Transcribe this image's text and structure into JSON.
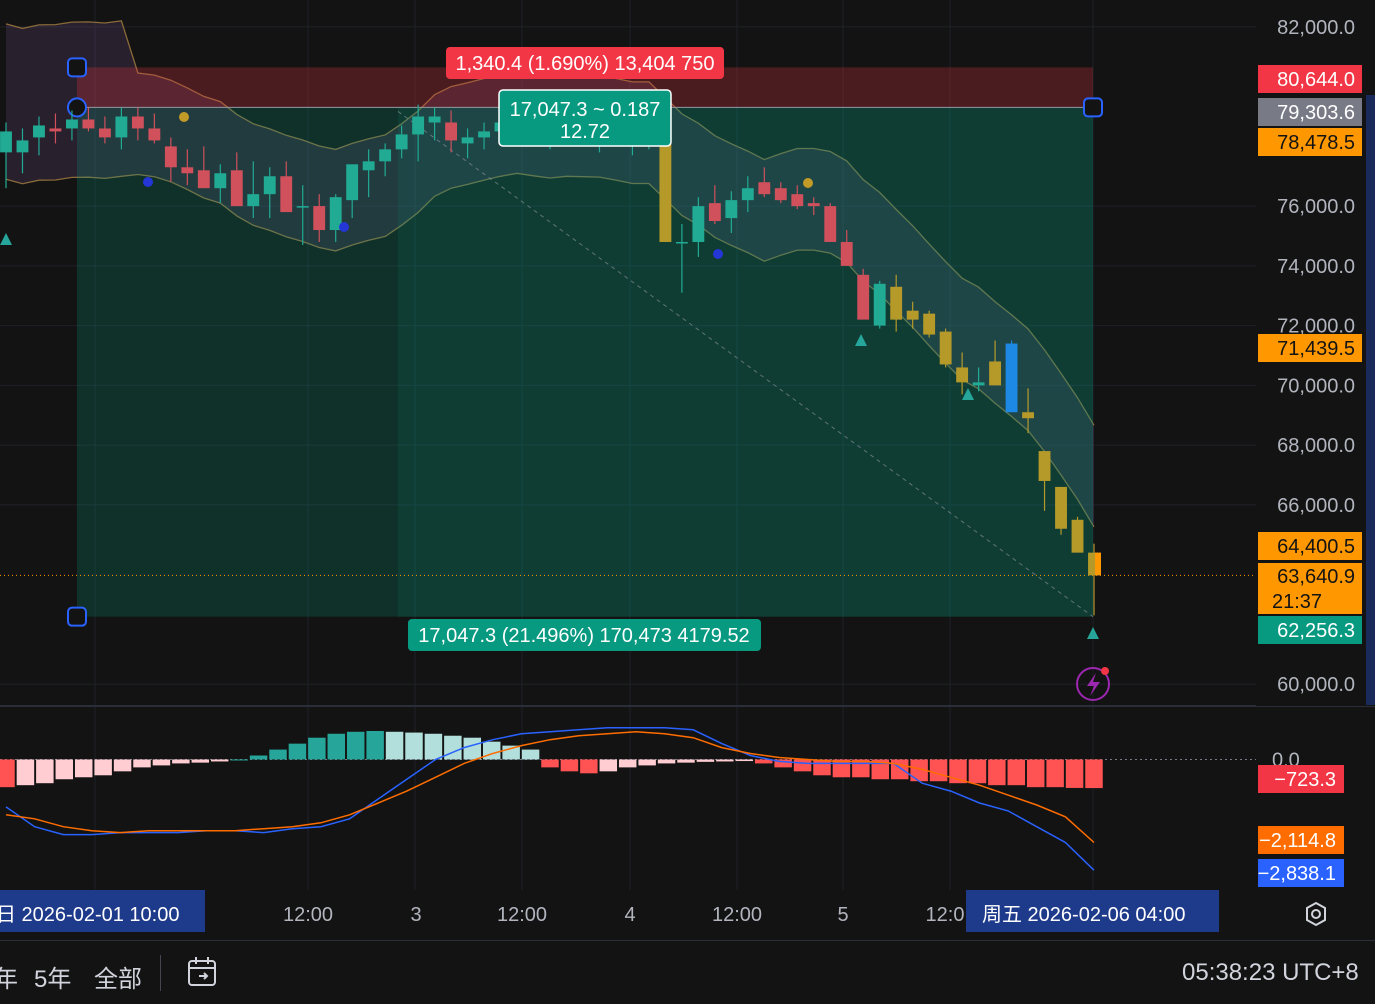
{
  "colors": {
    "background": "#131313",
    "up": "#089981",
    "down": "#f23645",
    "macd_line": "#2962ff",
    "signal_line": "#ff6d00",
    "hist_up_strong": "#26a69a",
    "hist_up_weak": "#b2dfdb",
    "hist_down_strong": "#ff5252",
    "hist_down_weak": "#ffcdd2",
    "label_red": "#f23645",
    "label_orange": "#ff9800",
    "label_green": "#089981",
    "label_gray": "#787b86"
  },
  "price_axis": {
    "ticks": [
      "82,000.0",
      "76,000.0",
      "74,000.0",
      "72,000.0",
      "70,000.0",
      "68,000.0",
      "66,000.0",
      "60,000.0"
    ],
    "tick_values": [
      82000,
      76000,
      74000,
      72000,
      70000,
      68000,
      66000,
      60000
    ],
    "labels": [
      {
        "text": "80,644.0",
        "value": 80644,
        "color": "#f23645",
        "text_color": "#ffffff"
      },
      {
        "text": "79,303.6",
        "value": 79303.6,
        "color": "#787b86",
        "text_color": "#ffffff"
      },
      {
        "text": "78,478.5",
        "value": 78478.5,
        "color": "#ff9800",
        "text_color": "#131313"
      },
      {
        "text": "71,439.5",
        "value": 71439.5,
        "color": "#ff9800",
        "text_color": "#131313"
      },
      {
        "text": "64,400.5",
        "value": 64400.5,
        "color": "#ff9800",
        "text_color": "#131313"
      },
      {
        "text": "63,640.9",
        "value": 63640.9,
        "color": "#ff9800",
        "text_color": "#131313"
      },
      {
        "text": "21:37",
        "value": null,
        "color": "#ff9800",
        "text_color": "#131313"
      },
      {
        "text": "62,256.3",
        "value": 62256.3,
        "color": "#089981",
        "text_color": "#ffffff"
      }
    ]
  },
  "macd_axis": {
    "ticks": [
      "0.0"
    ],
    "labels": [
      {
        "text": "−723.3",
        "value": -723.3,
        "color": "#f23645",
        "text_color": "#ffffff"
      },
      {
        "text": "−2,114.8",
        "value": -2114.8,
        "color": "#ff6d00",
        "text_color": "#ffffff"
      },
      {
        "text": "−2,838.1",
        "value": -2838.1,
        "color": "#2962ff",
        "text_color": "#ffffff"
      }
    ]
  },
  "time_axis": {
    "ticks": [
      "12:00",
      "3",
      "12:00",
      "4",
      "12:00",
      "5",
      "12:0"
    ],
    "left_label": "日 2026-02-01   10:00",
    "right_label": "周五 2026-02-06   04:00"
  },
  "annotations": {
    "top_label": "1,340.4 (1.690%) 13,404 750",
    "mid_label_line1": "17,047.3 ~ 0.187",
    "mid_label_line2": "12.72",
    "bottom_label": "17,047.3 (21.496%) 170,473 4179.52"
  },
  "position_tool": {
    "entry": 79303.6,
    "stop": 80644.0,
    "target": 62256.3
  },
  "bottom_toolbar": {
    "items": [
      "年",
      "5年",
      "全部"
    ],
    "clock": "05:38:23 UTC+8"
  },
  "chart_data": [
    {
      "type": "candlestick",
      "title": "",
      "ylim": [
        59300,
        82900
      ],
      "x": [
        "c1",
        "c2",
        "c3",
        "c4",
        "c5",
        "c6",
        "c7",
        "c8",
        "c9",
        "c10",
        "c11",
        "c12",
        "c13",
        "c14",
        "c15",
        "c16",
        "c17",
        "c18",
        "c19",
        "c20",
        "c21",
        "c22",
        "c23",
        "c24",
        "c25",
        "c26",
        "c27",
        "c28",
        "c29",
        "c30",
        "c31",
        "c32",
        "c33",
        "c34",
        "c35",
        "c36",
        "c37",
        "c38",
        "c39",
        "c40",
        "c41",
        "c42",
        "c43",
        "c44",
        "c45",
        "c46",
        "c47",
        "c48",
        "c49",
        "c50",
        "c51",
        "c52",
        "c53",
        "c54",
        "c55",
        "c56",
        "c57",
        "c58",
        "c59",
        "c60",
        "c61"
      ],
      "ohlc": [
        [
          77800,
          78800,
          76600,
          78500
        ],
        [
          77800,
          78600,
          77100,
          78200
        ],
        [
          78300,
          79000,
          77700,
          78700
        ],
        [
          78600,
          79100,
          78100,
          78500
        ],
        [
          78600,
          79200,
          78200,
          78900
        ],
        [
          78900,
          79300,
          78500,
          78600
        ],
        [
          78600,
          79000,
          78100,
          78300
        ],
        [
          78300,
          79300,
          77900,
          79000
        ],
        [
          79000,
          79300,
          78200,
          78600
        ],
        [
          78600,
          79100,
          78100,
          78200
        ],
        [
          78000,
          78300,
          76800,
          77300
        ],
        [
          77300,
          77900,
          76700,
          77100
        ],
        [
          77200,
          78000,
          76700,
          76600
        ],
        [
          76600,
          77400,
          76100,
          77100
        ],
        [
          77200,
          77800,
          76400,
          76000
        ],
        [
          76000,
          77500,
          75600,
          76400
        ],
        [
          76400,
          77300,
          75600,
          77000
        ],
        [
          77000,
          77500,
          75900,
          75800
        ],
        [
          76000,
          76700,
          74700,
          76000
        ],
        [
          76000,
          76400,
          74800,
          75200
        ],
        [
          75200,
          76400,
          74800,
          76300
        ],
        [
          76200,
          77100,
          75600,
          77400
        ],
        [
          77200,
          77900,
          76300,
          77500
        ],
        [
          77500,
          78100,
          77000,
          77900
        ],
        [
          77900,
          78700,
          77600,
          78400
        ],
        [
          78400,
          79400,
          77500,
          79000
        ],
        [
          78800,
          79300,
          78200,
          79000
        ],
        [
          78800,
          79200,
          77800,
          78200
        ],
        [
          78100,
          78600,
          77600,
          78300
        ],
        [
          78300,
          78800,
          77900,
          78500
        ],
        [
          78500,
          78900,
          78100,
          78800
        ],
        [
          78800,
          79400,
          78300,
          79100
        ],
        [
          79100,
          79400,
          78500,
          78400
        ],
        [
          78400,
          79000,
          77900,
          78500
        ],
        [
          78500,
          78900,
          78000,
          78600
        ],
        [
          78600,
          79100,
          78100,
          78200
        ],
        [
          78200,
          78800,
          77800,
          78400
        ],
        [
          78400,
          78900,
          78000,
          78100
        ],
        [
          78100,
          78600,
          77700,
          78300
        ],
        [
          78300,
          78800,
          77900,
          78400
        ],
        [
          78200,
          78600,
          76200,
          74800
        ],
        [
          74800,
          75400,
          73100,
          74800
        ],
        [
          74800,
          76300,
          74300,
          76000
        ],
        [
          76100,
          76700,
          75400,
          75500
        ],
        [
          75600,
          76500,
          75100,
          76200
        ],
        [
          76200,
          77000,
          75800,
          76600
        ],
        [
          76800,
          77300,
          76300,
          76400
        ],
        [
          76600,
          76800,
          76100,
          76200
        ],
        [
          76400,
          76700,
          75900,
          76000
        ],
        [
          76100,
          76300,
          75700,
          76000
        ],
        [
          76000,
          76100,
          75000,
          74800
        ],
        [
          74800,
          75200,
          74000,
          74000
        ],
        [
          73700,
          73900,
          72400,
          72200
        ],
        [
          72000,
          73500,
          71900,
          73400
        ],
        [
          73300,
          73700,
          71800,
          72200
        ],
        [
          72500,
          72800,
          71900,
          72200
        ],
        [
          72400,
          72500,
          71600,
          71700
        ],
        [
          71800,
          71900,
          70600,
          70700
        ],
        [
          70600,
          71100,
          69700,
          70100
        ],
        [
          70000,
          70600,
          69800,
          70100
        ],
        [
          70800,
          71500,
          70000,
          70000
        ]
      ],
      "ohlc_tail": [
        [
          71400,
          71500,
          69800,
          69100
        ],
        [
          69100,
          69900,
          68400,
          68900
        ],
        [
          67800,
          67800,
          65800,
          66800
        ],
        [
          66600,
          66600,
          65000,
          65200
        ],
        [
          65500,
          65600,
          64800,
          64400
        ],
        [
          64400,
          64700,
          62300,
          63640.9
        ]
      ]
    },
    {
      "type": "line",
      "title": "",
      "series": [
        {
          "values": [
            -1200,
            -1700,
            -1900,
            -1900,
            -1850,
            -1850,
            -1850,
            -1800,
            -1800,
            -1850,
            -1750,
            -1700,
            -1500,
            -1000,
            -500,
            0,
            300,
            500,
            650,
            700,
            750,
            800,
            800,
            800,
            750,
            400,
            100,
            -50,
            -100,
            -100,
            -100,
            -100,
            -600,
            -800,
            -1100,
            -1300,
            -1700,
            -2100,
            -2800
          ]
        },
        {
          "values": [
            -1400,
            -1500,
            -1700,
            -1800,
            -1850,
            -1800,
            -1800,
            -1800,
            -1800,
            -1750,
            -1700,
            -1600,
            -1400,
            -1100,
            -800,
            -450,
            -100,
            150,
            350,
            500,
            600,
            650,
            700,
            650,
            550,
            300,
            150,
            50,
            0,
            -50,
            -50,
            -100,
            -250,
            -450,
            -650,
            -900,
            -1150,
            -1450,
            -2100
          ]
        }
      ]
    },
    {
      "type": "bar",
      "title": "",
      "series": [
        {
          "values": [
            -700,
            -650,
            -600,
            -500,
            -450,
            -400,
            -300,
            -200,
            -150,
            -100,
            -80,
            -50,
            0,
            100,
            250,
            400,
            550,
            650,
            700,
            720,
            700,
            680,
            650,
            600,
            550,
            450,
            350,
            250,
            -200,
            -300,
            -350,
            -300,
            -200,
            -150,
            -100,
            -80,
            -60,
            -50,
            -40,
            -100,
            -200,
            -300,
            -400,
            -450,
            -450,
            -500,
            -500,
            -550,
            -550,
            -600,
            -600,
            -650,
            -650,
            -700,
            -700,
            -720,
            -723.3
          ]
        }
      ]
    }
  ]
}
